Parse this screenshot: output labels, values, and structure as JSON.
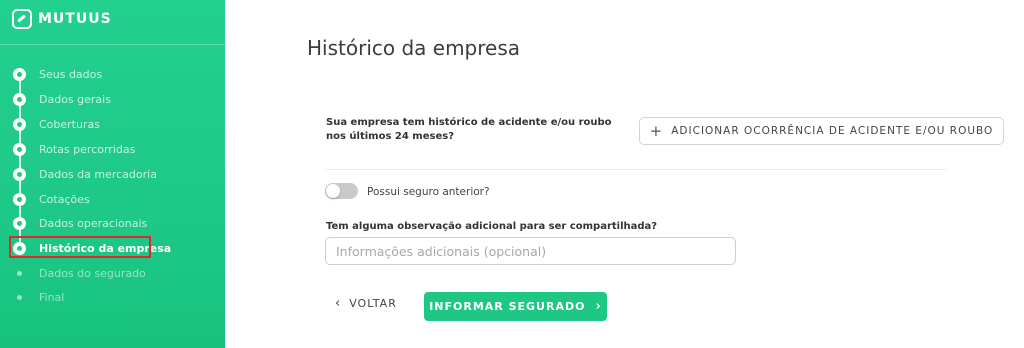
{
  "brand": {
    "name": "MUTUUS",
    "accent": "#22d08f",
    "highlight": "#e3252c"
  },
  "sidebar": {
    "steps": [
      {
        "label": "Seus dados",
        "state": "done"
      },
      {
        "label": "Dados gerais",
        "state": "done"
      },
      {
        "label": "Coberturas",
        "state": "done"
      },
      {
        "label": "Rotas percorridas",
        "state": "done"
      },
      {
        "label": "Dados da mercadoria",
        "state": "done"
      },
      {
        "label": "Cotações",
        "state": "done"
      },
      {
        "label": "Dados operacionais",
        "state": "done"
      },
      {
        "label": "Histórico da empresa",
        "state": "active"
      },
      {
        "label": "Dados do segurado",
        "state": "pending"
      },
      {
        "label": "Final",
        "state": "pending"
      }
    ]
  },
  "main": {
    "title": "Histórico da empresa",
    "question": "Sua empresa tem histórico de acidente e/ou roubo nos últimos 24 meses?",
    "add_button": {
      "icon": "plus-icon",
      "label": "ADICIONAR OCORRÊNCIA DE ACIDENTE E/OU ROUBO"
    },
    "toggle": {
      "label": "Possui seguro anterior?",
      "checked": false
    },
    "observation": {
      "label": "Tem alguma observação adicional para ser compartilhada?",
      "value": "",
      "placeholder": "Informações adicionais (opcional)"
    },
    "back_button": {
      "icon": "chevron-left-icon",
      "label": "VOLTAR"
    },
    "next_button": {
      "icon": "chevron-right-icon",
      "label": "INFORMAR SEGURADO"
    }
  }
}
